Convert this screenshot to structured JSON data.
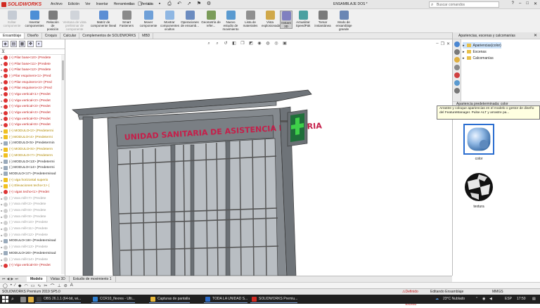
{
  "app": {
    "logo_brand": "DS",
    "logo_name": "SOLIDWORKS",
    "document_title": "ENSAMBLAJE DOS *"
  },
  "menu": [
    "Archivo",
    "Edición",
    "Ver",
    "Insertar",
    "Herramientas",
    "Ventana"
  ],
  "search": {
    "placeholder": "Buscar comandos"
  },
  "ribbon": [
    {
      "label": "Editar componente",
      "disabled": true,
      "color": "#9aa6b8"
    },
    {
      "label": "Insertar componentes",
      "disabled": false,
      "color": "#4d8fd6"
    },
    {
      "label": "Relación de posición",
      "disabled": false,
      "color": "#7c7c7c"
    },
    {
      "label": "Ventana de vista preliminar de componente",
      "disabled": true,
      "color": "#b0b8c4"
    },
    {
      "label": "Matriz de componente lineal",
      "disabled": false,
      "color": "#5c8ed4"
    },
    {
      "label": "Smart Fasteners",
      "disabled": false,
      "color": "#8a8a8a"
    },
    {
      "label": "Mover componente",
      "disabled": false,
      "color": "#6fa0d8"
    },
    {
      "label": "Mostrar componentes ocultos",
      "disabled": false,
      "color": "#8fb7e3"
    },
    {
      "label": "Operaciones de ensamb...",
      "disabled": false,
      "color": "#6c8cc0"
    },
    {
      "label": "Geometría de refer...",
      "disabled": false,
      "color": "#7b9c5a"
    },
    {
      "label": "Nuevo estudio de movimiento",
      "disabled": false,
      "color": "#5a9ad0"
    },
    {
      "label": "Lista de materiales",
      "disabled": false,
      "color": "#909090"
    },
    {
      "label": "Vista explosionada",
      "disabled": false,
      "color": "#d0a84a"
    },
    {
      "label": "Instant 3D",
      "disabled": false,
      "selected": true,
      "color": "#8080c0"
    },
    {
      "label": "Actualizar SpeedPak",
      "disabled": false,
      "color": "#4aa0a0"
    },
    {
      "label": "Tomar instantánea",
      "disabled": false,
      "color": "#7a7a7a"
    },
    {
      "label": "Modo de ensamblaje grande",
      "disabled": false,
      "color": "#6a86b4"
    }
  ],
  "tabs": [
    "Ensamblaje",
    "Diseño",
    "Croquis",
    "Calcular",
    "Complementos de SOLIDWORKS",
    "MBD"
  ],
  "tree": [
    {
      "text": "(+) Pilar base<10> (Predete",
      "state": "red"
    },
    {
      "text": "(+) Pilar base<11> (Predete",
      "state": "red"
    },
    {
      "text": "(+) Pilar base<12> (Predete",
      "state": "red"
    },
    {
      "text": "(-) Pilar esquinero<1> (Pred",
      "state": "red"
    },
    {
      "text": "(+) Pilar esquinero<2> (Pred",
      "state": "red"
    },
    {
      "text": "(+) Pilar esquinero<4> (Pred",
      "state": "red"
    },
    {
      "text": "(+) Viga vertical<1> (Predet",
      "state": "red"
    },
    {
      "text": "(+) Viga vertical<2> (Predet",
      "state": "red"
    },
    {
      "text": "(+) Viga vertical<3> (Predet",
      "state": "red"
    },
    {
      "text": "(+) Viga vertical<4> (Predet",
      "state": "red"
    },
    {
      "text": "(+) Viga vertical<5> (Predet",
      "state": "red"
    },
    {
      "text": "(+) Viga vertical<6> (Predet",
      "state": "red"
    },
    {
      "text": "(+) MODULO<2> (Predetermi",
      "state": "warn"
    },
    {
      "text": "(-) MODULO<4> (Predetermi",
      "state": "warn"
    },
    {
      "text": "(-) MODULO<5> (Predetermin",
      "state": "blk"
    },
    {
      "text": "(+) MODULO<6> (Predeterm",
      "state": "warn"
    },
    {
      "text": "(+) MODULO<7> (Predeterm",
      "state": "warn"
    },
    {
      "text": "(-) MODULO<13> (Predetermi",
      "state": "blk"
    },
    {
      "text": "(-) MODULO<14> (Predetermi",
      "state": "blk"
    },
    {
      "text": "MODULO<17> (Predeterminad",
      "state": "blk"
    },
    {
      "text": "(+) viga horizontal superio",
      "state": "warn"
    },
    {
      "text": "(+) Elevaciones techo<1> (",
      "state": "warn"
    },
    {
      "text": "(+) vigas techo<1> (Predet",
      "state": "red"
    },
    {
      "text": "(-) Vara mill<7> (Predete",
      "state": "gray"
    },
    {
      "text": "(-) Vara mill<2> (Predete",
      "state": "gray"
    },
    {
      "text": "(-) Vara mill<8> (Predete",
      "state": "gray"
    },
    {
      "text": "(-) Vara mill<9> (Predete",
      "state": "gray"
    },
    {
      "text": "(-) Vara mill<10> (Predete",
      "state": "gray"
    },
    {
      "text": "(-) Vara mill<11> (Predete",
      "state": "gray"
    },
    {
      "text": "(-) Vara mill<12> (Predete",
      "state": "gray"
    },
    {
      "text": "MODULO<19> (Predeterminad",
      "state": "blk"
    },
    {
      "text": "(-) Vara mill<13> (Predete",
      "state": "gray"
    },
    {
      "text": "MODULO<20> (Predeterminad",
      "state": "blk"
    },
    {
      "text": "(-) Vara mill<14> (Predete",
      "state": "gray"
    },
    {
      "text": "(+) Viga vertical<9> (Predet",
      "state": "red"
    }
  ],
  "model": {
    "sign_text": "UNIDAD SANITARIA DE ASISTENCIA PRIMARIA"
  },
  "right_panel": {
    "title": "Apariencias, escenas y calcomanías",
    "items": [
      "Apariencias(color)",
      "Escenas",
      "Calcomanías"
    ],
    "preview_header": "Apariencia predeterminada: color",
    "tooltip": "Arrastre y coloque apariencias en el modelo o gestor de diseño del FeatureManager. Pulse ALT y arrastre pa...",
    "thumbs": [
      "color",
      "textura"
    ]
  },
  "bottom_tabs": [
    "Modelo",
    "Vistas 3D",
    "Estudio de movimiento 1"
  ],
  "status": {
    "left": "SOLIDWORKS Premium 2019 SP5.0",
    "defined": "Definido en exceso",
    "editing": "Editando Ensamblaje",
    "units": "MMGS"
  },
  "taskbar": {
    "tasks": [
      {
        "label": "OBS 26.1.1 (64-bit, wi...",
        "color": "#3a3a3a"
      },
      {
        "label": "CCR10_flexres - Ulti...",
        "color": "#2f7fd0"
      },
      {
        "label": "Capturas de pantalla",
        "color": "#e8b83a"
      },
      {
        "label": "TODA LA UNIDAD S...",
        "color": "#2a6ac8"
      },
      {
        "label": "SOLIDWORKS Premiu...",
        "color": "#d12a22"
      }
    ],
    "weather": "23°C  Nublado",
    "lang": "ESP",
    "time": "17:50"
  }
}
